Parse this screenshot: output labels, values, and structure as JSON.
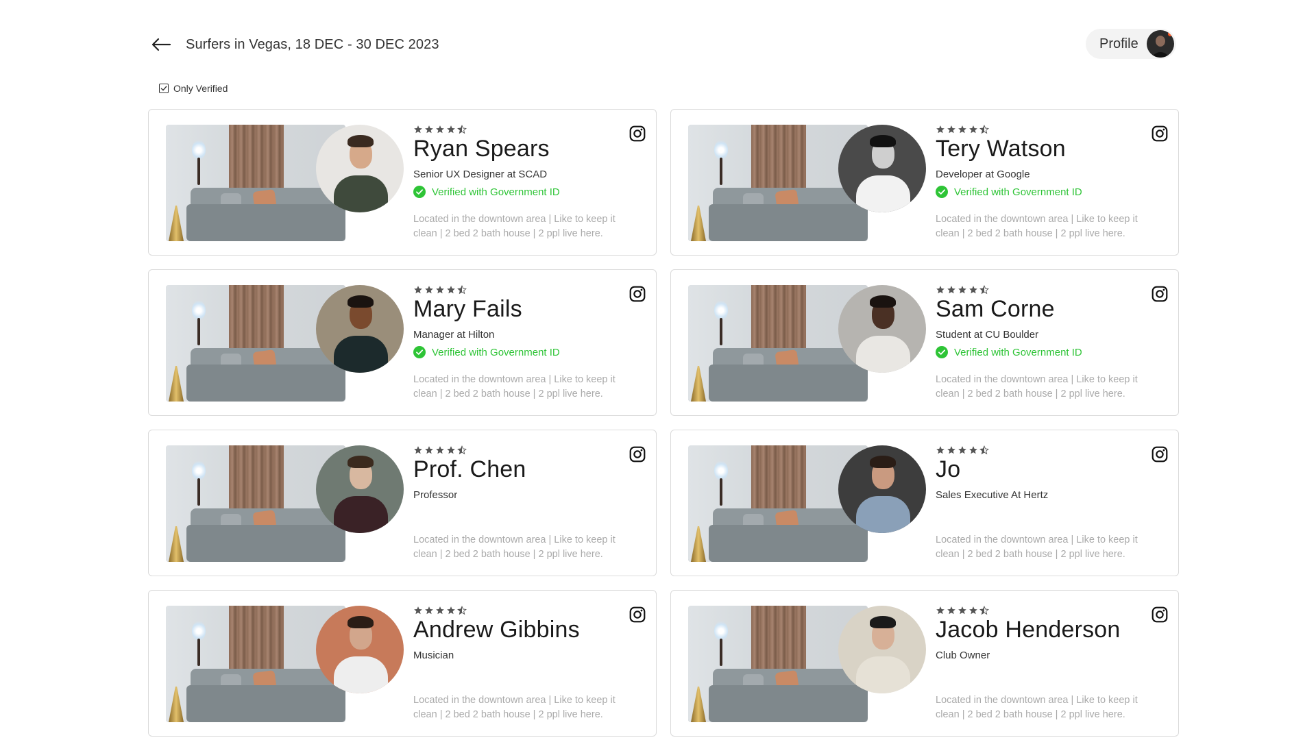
{
  "header": {
    "title": "Surfers in Vegas, 18 DEC - 30 DEC 2023"
  },
  "profile": {
    "label": "Profile"
  },
  "filter": {
    "label": "Only Verified",
    "checked": true
  },
  "colors": {
    "verified": "#2ec436",
    "star": "#555555",
    "border": "#dadada"
  },
  "hosts": [
    {
      "name": "Ryan Spears",
      "job": "Senior UX Designer at SCAD",
      "verified": true,
      "verified_label": "Verified with Government ID",
      "rating": 4.5,
      "description": "Located in the downtown area | Like to keep it clean | 2 bed 2 bath house | 2 ppl live here.",
      "avatar": {
        "bg": "#e8e6e3",
        "skin": "#d6a98a",
        "shirt": "#3f4a3c",
        "hair": "#3a2a20"
      }
    },
    {
      "name": "Tery Watson",
      "job": "Developer at Google",
      "verified": true,
      "verified_label": "Verified with Government ID",
      "rating": 4.5,
      "description": "Located in the downtown area | Like to keep it clean | 2 bed 2 bath house | 2 ppl live here.",
      "avatar": {
        "bg": "#4a4a4a",
        "skin": "#cfcfcf",
        "shirt": "#f2f2f2",
        "hair": "#111111"
      }
    },
    {
      "name": "Mary Fails",
      "job": "Manager at Hilton",
      "verified": true,
      "verified_label": "Verified with Government ID",
      "rating": 4.5,
      "description": "Located in the downtown area | Like to keep it clean | 2 bed 2 bath house | 2 ppl live here.",
      "avatar": {
        "bg": "#9a8e7a",
        "skin": "#7a4a2e",
        "shirt": "#1c2a2c",
        "hair": "#1a1310"
      }
    },
    {
      "name": "Sam Corne",
      "job": "Student at CU Boulder",
      "verified": true,
      "verified_label": "Verified with Government ID",
      "rating": 4.5,
      "description": "Located in the downtown area | Like to keep it clean | 2 bed 2 bath house | 2 ppl live here.",
      "avatar": {
        "bg": "#b6b4b0",
        "skin": "#4a3024",
        "shirt": "#e9e7e3",
        "hair": "#1a1310"
      }
    },
    {
      "name": "Prof. Chen",
      "job": "Professor",
      "verified": false,
      "verified_label": "",
      "rating": 4.5,
      "description": "Located in the downtown area | Like to keep it clean | 2 bed 2 bath house | 2 ppl live here.",
      "avatar": {
        "bg": "#6f7a72",
        "skin": "#d8b8a0",
        "shirt": "#3a2226",
        "hair": "#3b2a1e"
      }
    },
    {
      "name": "Jo",
      "job": "Sales Executive At Hertz",
      "verified": false,
      "verified_label": "",
      "rating": 4.5,
      "description": "Located in the downtown area | Like to keep it clean | 2 bed 2 bath house | 2 ppl live here.",
      "avatar": {
        "bg": "#3d3d3d",
        "skin": "#c99a80",
        "shirt": "#8aa0b8",
        "hair": "#2a1d16"
      }
    },
    {
      "name": "Andrew Gibbins",
      "job": "Musician",
      "verified": false,
      "verified_label": "",
      "rating": 4.5,
      "description": "Located in the downtown area | Like to keep it clean | 2 bed 2 bath house | 2 ppl live here.",
      "avatar": {
        "bg": "#c77a5a",
        "skin": "#d2a68c",
        "shirt": "#eeeeee",
        "hair": "#2a1d16"
      }
    },
    {
      "name": "Jacob Henderson",
      "job": "Club Owner",
      "verified": false,
      "verified_label": "",
      "rating": 4.5,
      "description": "Located in the downtown area | Like to keep it clean | 2 bed 2 bath house | 2 ppl live here.",
      "avatar": {
        "bg": "#d9d3c6",
        "skin": "#d7b097",
        "shirt": "#e6e1d6",
        "hair": "#1a1a1a"
      }
    }
  ]
}
